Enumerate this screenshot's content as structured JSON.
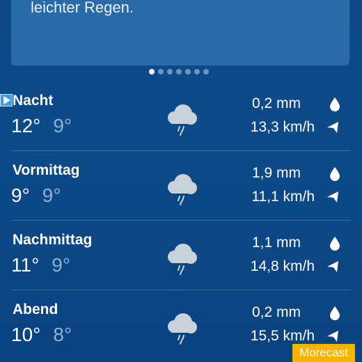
{
  "card": {
    "text": "leichter Regen."
  },
  "pager": {
    "count": 7,
    "active_index": 0
  },
  "forecast": [
    {
      "period": "Nacht",
      "max": "12°",
      "min": "9°",
      "precip": "0,2 mm",
      "wind": "13,3 km/h",
      "icon": "cloud-rain-icon"
    },
    {
      "period": "Vormittag",
      "max": "9°",
      "min": "9°",
      "precip": "1,9 mm",
      "wind": "11,1 km/h",
      "icon": "cloud-rain-icon"
    },
    {
      "period": "Nachmittag",
      "max": "11°",
      "min": "9°",
      "precip": "1,1 mm",
      "wind": "14,8 km/h",
      "icon": "cloud-rain-icon"
    },
    {
      "period": "Abend",
      "max": "10°",
      "min": "8°",
      "precip": "0,2 mm",
      "wind": "15,5 km/h",
      "icon": "cloud-rain-icon"
    }
  ],
  "brand": {
    "label": "Morecast",
    "color": "#f5b400"
  },
  "colors": {
    "background": "#0d4a88",
    "card": "#2a6aa8",
    "min_temp": "#8eb1d6"
  }
}
